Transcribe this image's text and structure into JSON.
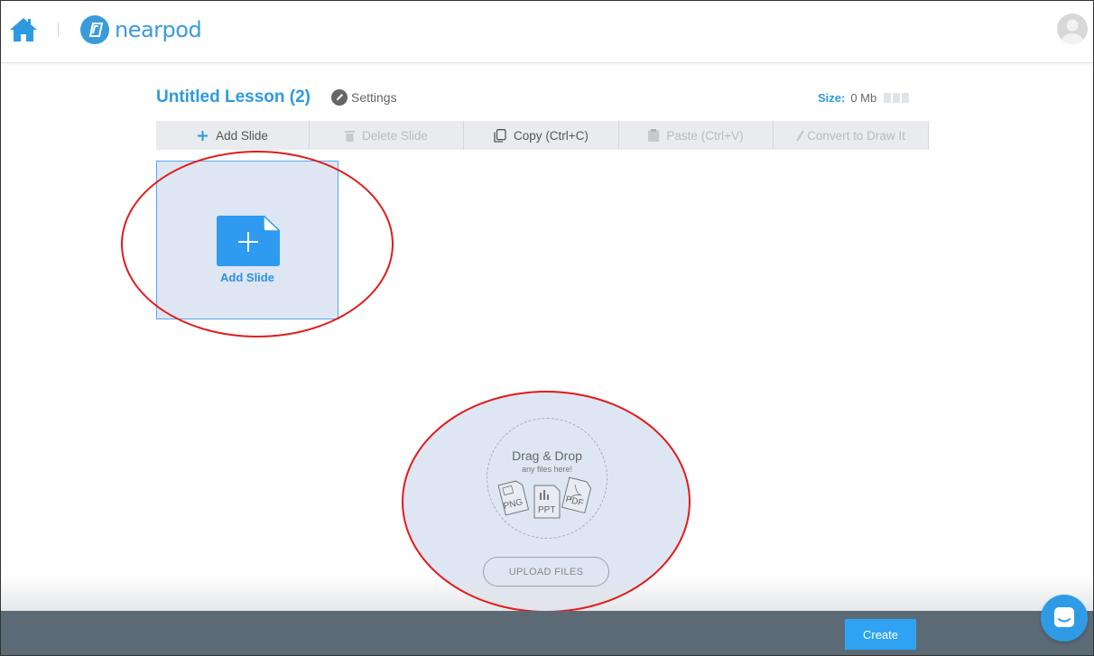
{
  "header": {
    "brand": "nearpod",
    "home_icon": "home-icon",
    "avatar_icon": "user-avatar-icon"
  },
  "lesson": {
    "title": "Untitled Lesson (2)",
    "settings_label": "Settings",
    "size_label": "Size:",
    "size_value": "0 Mb"
  },
  "toolbar": {
    "add_slide": "Add Slide",
    "delete_slide": "Delete Slide",
    "copy": "Copy (Ctrl+C)",
    "paste": "Paste (Ctrl+V)",
    "convert": "Convert to Draw It"
  },
  "tile": {
    "add_slide_label": "Add Slide"
  },
  "dropzone": {
    "title": "Drag & Drop",
    "subtitle": "any files here!",
    "file_types": [
      "PNG",
      "PPT",
      "PDF"
    ],
    "upload_label": "UPLOAD FILES"
  },
  "footer": {
    "create_label": "Create"
  },
  "colors": {
    "accent": "#2d9ae0",
    "highlight": "#dfe6f3",
    "annotation": "#e31b1b",
    "footer": "#5c6a76"
  }
}
